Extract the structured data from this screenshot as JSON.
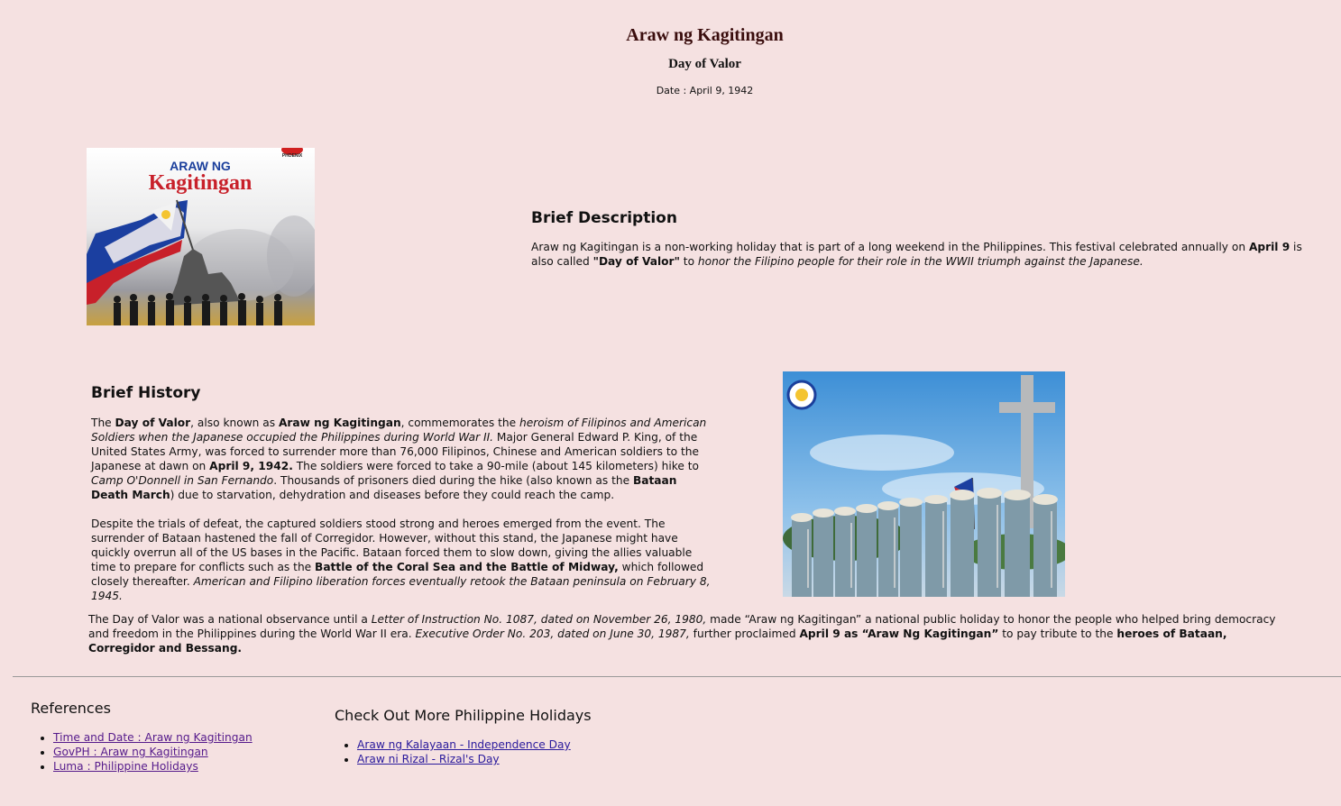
{
  "header": {
    "title": "Araw ng Kagitingan",
    "subtitle": "Day of Valor",
    "date": "Date : April 9, 1942"
  },
  "hero_image": {
    "line1": "ARAW NG",
    "line2": "Kagitingan",
    "brand": "PHOENIX"
  },
  "description": {
    "title": "Brief Description",
    "p1_a": "Araw ng Kagitingan is a non-working holiday that is part of a long weekend in the Philippines. This festival celebrated annually on ",
    "p1_b": "April 9",
    "p1_c": " is also called ",
    "p1_d": "\"Day of Valor\"",
    "p1_e": " to ",
    "p1_f": "honor the Filipino people for their role in the WWII triumph against the Japanese."
  },
  "history": {
    "title": "Brief History",
    "p1": [
      {
        "t": "The ",
        "s": "n"
      },
      {
        "t": "Day of Valor",
        "s": "b"
      },
      {
        "t": ", also known as ",
        "s": "n"
      },
      {
        "t": "Araw ng Kagitingan",
        "s": "b"
      },
      {
        "t": ", commemorates the ",
        "s": "n"
      },
      {
        "t": "heroism of Filipinos and American Soldiers when the Japanese occupied the Philippines during World War II.",
        "s": "i"
      },
      {
        "t": " Major General Edward P. King, of the United States Army, was forced to surrender more than 76,000 Filipinos, Chinese and American soldiers to the Japanese at dawn on ",
        "s": "n"
      },
      {
        "t": "April 9, 1942.",
        "s": "b"
      },
      {
        "t": " The soldiers were forced to take a 90-mile (about 145 kilometers) hike to ",
        "s": "n"
      },
      {
        "t": "Camp O'Donnell in San Fernando",
        "s": "i"
      },
      {
        "t": ". Thousands of prisoners died during the hike (also known as the ",
        "s": "n"
      },
      {
        "t": "Bataan Death March",
        "s": "b"
      },
      {
        "t": ") due to starvation, dehydration and diseases before they could reach the camp.",
        "s": "n"
      }
    ],
    "p2": [
      {
        "t": "Despite the trials of defeat, the captured soldiers stood strong and heroes emerged from the event. The surrender of Bataan hastened the fall of Corregidor. However, without this stand, the Japanese might have quickly overrun all of the US bases in the Pacific. Bataan forced them to slow down, giving the allies valuable time to prepare for conflicts such as the ",
        "s": "n"
      },
      {
        "t": "Battle of the Coral Sea and the Battle of Midway,",
        "s": "b"
      },
      {
        "t": " which followed closely thereafter. ",
        "s": "n"
      },
      {
        "t": "American and Filipino liberation forces eventually retook the Bataan peninsula on February 8, 1945.",
        "s": "i"
      }
    ],
    "p3": [
      {
        "t": "The Day of Valor was a national observance until a ",
        "s": "n"
      },
      {
        "t": "Letter of Instruction No. 1087, dated on November 26, 1980,",
        "s": "i"
      },
      {
        "t": " made “Araw ng Kagitingan” a national public holiday to honor the people who helped bring democracy and freedom in the Philippines during the World War II era. ",
        "s": "n"
      },
      {
        "t": "Executive Order No. 203, dated on June 30, 1987,",
        "s": "i"
      },
      {
        "t": " further proclaimed ",
        "s": "n"
      },
      {
        "t": "April 9 as “Araw Ng Kagitingan”",
        "s": "b"
      },
      {
        "t": " to pay tribute to the ",
        "s": "n"
      },
      {
        "t": "heroes of Bataan, Corregidor and Bessang.",
        "s": "b"
      }
    ]
  },
  "references": {
    "title": "References",
    "links": [
      "Time and Date : Araw ng Kagitingan",
      "GovPH : Araw ng Kagitingan",
      "Luma : Philippine Holidays"
    ]
  },
  "more": {
    "title": "Check Out More Philippine Holidays",
    "links": [
      "Araw ng Kalayaan - Independence Day",
      "Araw ni Rizal - Rizal's Day"
    ]
  },
  "colors": {
    "background": "#f5e1e1",
    "link": "#2a1a9c",
    "link_visited": "#551a8b",
    "title": "#3a0d0d"
  }
}
